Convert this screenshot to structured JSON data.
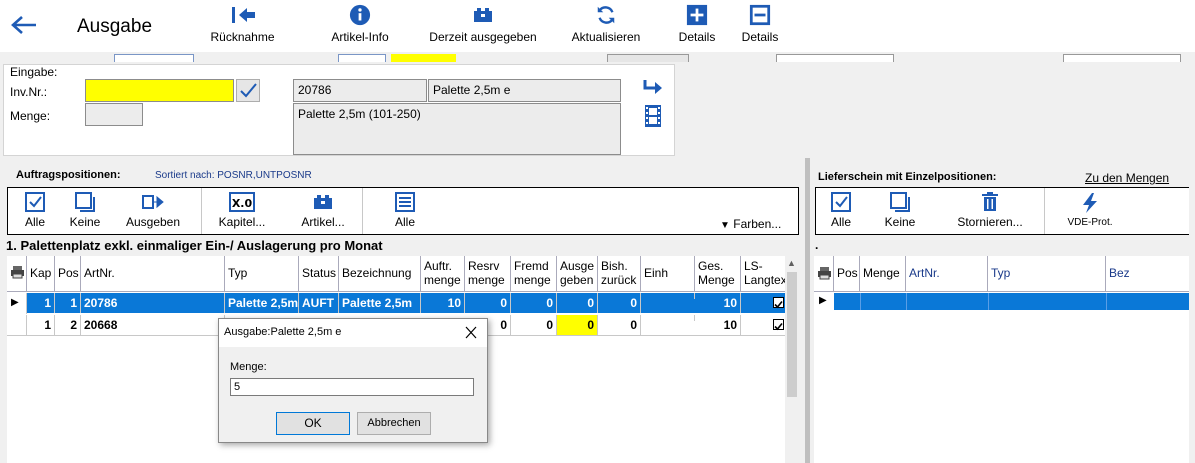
{
  "header": {
    "title": "Ausgabe",
    "toolbar": [
      {
        "label": "Rücknahme",
        "icon": "return-icon"
      },
      {
        "label": "Artikel-Info",
        "icon": "info-icon"
      },
      {
        "label": "Derzeit ausgegeben",
        "icon": "box-icon"
      },
      {
        "label": "Aktualisieren",
        "icon": "refresh-icon"
      },
      {
        "label": "Details",
        "icon": "plus-icon"
      },
      {
        "label": "Details",
        "icon": "minus-icon"
      }
    ]
  },
  "eingabe": {
    "section_label": "Eingabe:",
    "invnr_label": "Inv.Nr.:",
    "invnr_value": "",
    "menge_label": "Menge:",
    "menge_value": "",
    "artnr": "20786",
    "bez_short": "Palette 2,5m e",
    "bez_long": "Palette 2,5m (101-250)"
  },
  "left": {
    "title": "Auftragspositionen:",
    "sort": "Sortiert nach: POSNR,UNTPOSNR",
    "buttons": [
      "Alle",
      "Keine",
      "Ausgeben",
      "Kapitel...",
      "Artikel...",
      "Alle",
      "Farben..."
    ],
    "chapter": "1. Palettenplatz exkl. einmaliger Ein-/ Auslagerung pro Monat",
    "columns": [
      "Kap",
      "Pos",
      "ArtNr.",
      "Typ",
      "Status",
      "Bezeichnung",
      "Auftr. menge",
      "Resrv menge",
      "Fremd menge",
      "Ausge geben",
      "Bish. zurück",
      "Einh",
      "Ges. Menge",
      "LS- Langtext"
    ],
    "rows": [
      {
        "kap": "1",
        "pos": "1",
        "artnr": "20786",
        "typ": "Palette 2,5m",
        "status": "AUFT",
        "bez": "Palette 2,5m",
        "auftr": "10",
        "resrv": "0",
        "fremd": "0",
        "ausg": "0",
        "bish": "0",
        "einh": "",
        "ges": "10",
        "selected": true
      },
      {
        "kap": "1",
        "pos": "2",
        "artnr": "20668",
        "typ": "",
        "status": "",
        "bez": "",
        "auftr": "",
        "resrv": "0",
        "fremd": "0",
        "ausg": "0",
        "bish": "0",
        "einh": "",
        "ges": "10",
        "selected": false
      }
    ]
  },
  "right": {
    "title": "Lieferschein mit Einzelpositionen:",
    "link": "Zu den Mengen",
    "buttons": [
      "Alle",
      "Keine",
      "Stornieren...",
      "VDE-Prot."
    ],
    "columns": [
      "Pos",
      "Menge",
      "ArtNr.",
      "Typ",
      "Bez"
    ]
  },
  "dialog": {
    "title": "Ausgabe:Palette 2,5m e",
    "label": "Menge:",
    "value": "5",
    "ok": "OK",
    "cancel": "Abbrechen"
  },
  "colors": {
    "selection": "#0a78d7",
    "highlight": "#ffff00",
    "accent": "#1e5bb5"
  }
}
